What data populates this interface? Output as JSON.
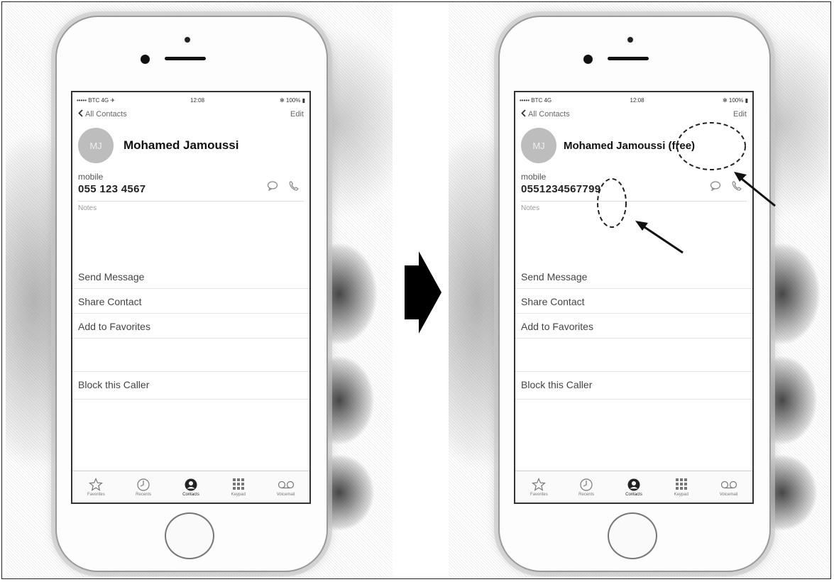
{
  "comparison": {
    "before": {
      "status": {
        "carrier": "••••• BTC  4G ✈",
        "time": "12:08",
        "battery": "✻ 100% ▮"
      },
      "nav": {
        "back_label": "All Contacts",
        "edit_label": "Edit"
      },
      "contact": {
        "initials": "MJ",
        "name": "Mohamed Jamoussi",
        "phone_label": "mobile",
        "phone_number": "055 123 4567",
        "notes_label": "Notes"
      },
      "actions": [
        "Send Message",
        "Share Contact",
        "Add to Favorites"
      ],
      "block_label": "Block this Caller",
      "tabs": [
        {
          "label": "Favorites",
          "icon": "star-icon"
        },
        {
          "label": "Recents",
          "icon": "clock-icon"
        },
        {
          "label": "Contacts",
          "icon": "contacts-icon"
        },
        {
          "label": "Keypad",
          "icon": "keypad-icon"
        },
        {
          "label": "Voicemail",
          "icon": "voicemail-icon"
        }
      ],
      "active_tab": "Contacts"
    },
    "after": {
      "status": {
        "carrier": "••••• BTC  4G",
        "time": "12:08",
        "battery": "✻ 100% ▮"
      },
      "nav": {
        "back_label": "All Contacts",
        "edit_label": "Edit"
      },
      "contact": {
        "initials": "MJ",
        "name": "Mohamed Jamoussi (free)",
        "phone_label": "mobile",
        "phone_number": "0551234567799",
        "notes_label": "Notes"
      },
      "actions": [
        "Send Message",
        "Share Contact",
        "Add to Favorites"
      ],
      "block_label": "Block this Caller",
      "tabs": [
        {
          "label": "Favorites",
          "icon": "star-icon"
        },
        {
          "label": "Recents",
          "icon": "clock-icon"
        },
        {
          "label": "Contacts",
          "icon": "contacts-icon"
        },
        {
          "label": "Keypad",
          "icon": "keypad-icon"
        },
        {
          "label": "Voicemail",
          "icon": "voicemail-icon"
        }
      ],
      "active_tab": "Contacts"
    }
  },
  "colors": {
    "arrow": "#000000",
    "annotation": "#222222",
    "screen_bg": "#ffffff",
    "avatar": "#bdbdbd"
  }
}
